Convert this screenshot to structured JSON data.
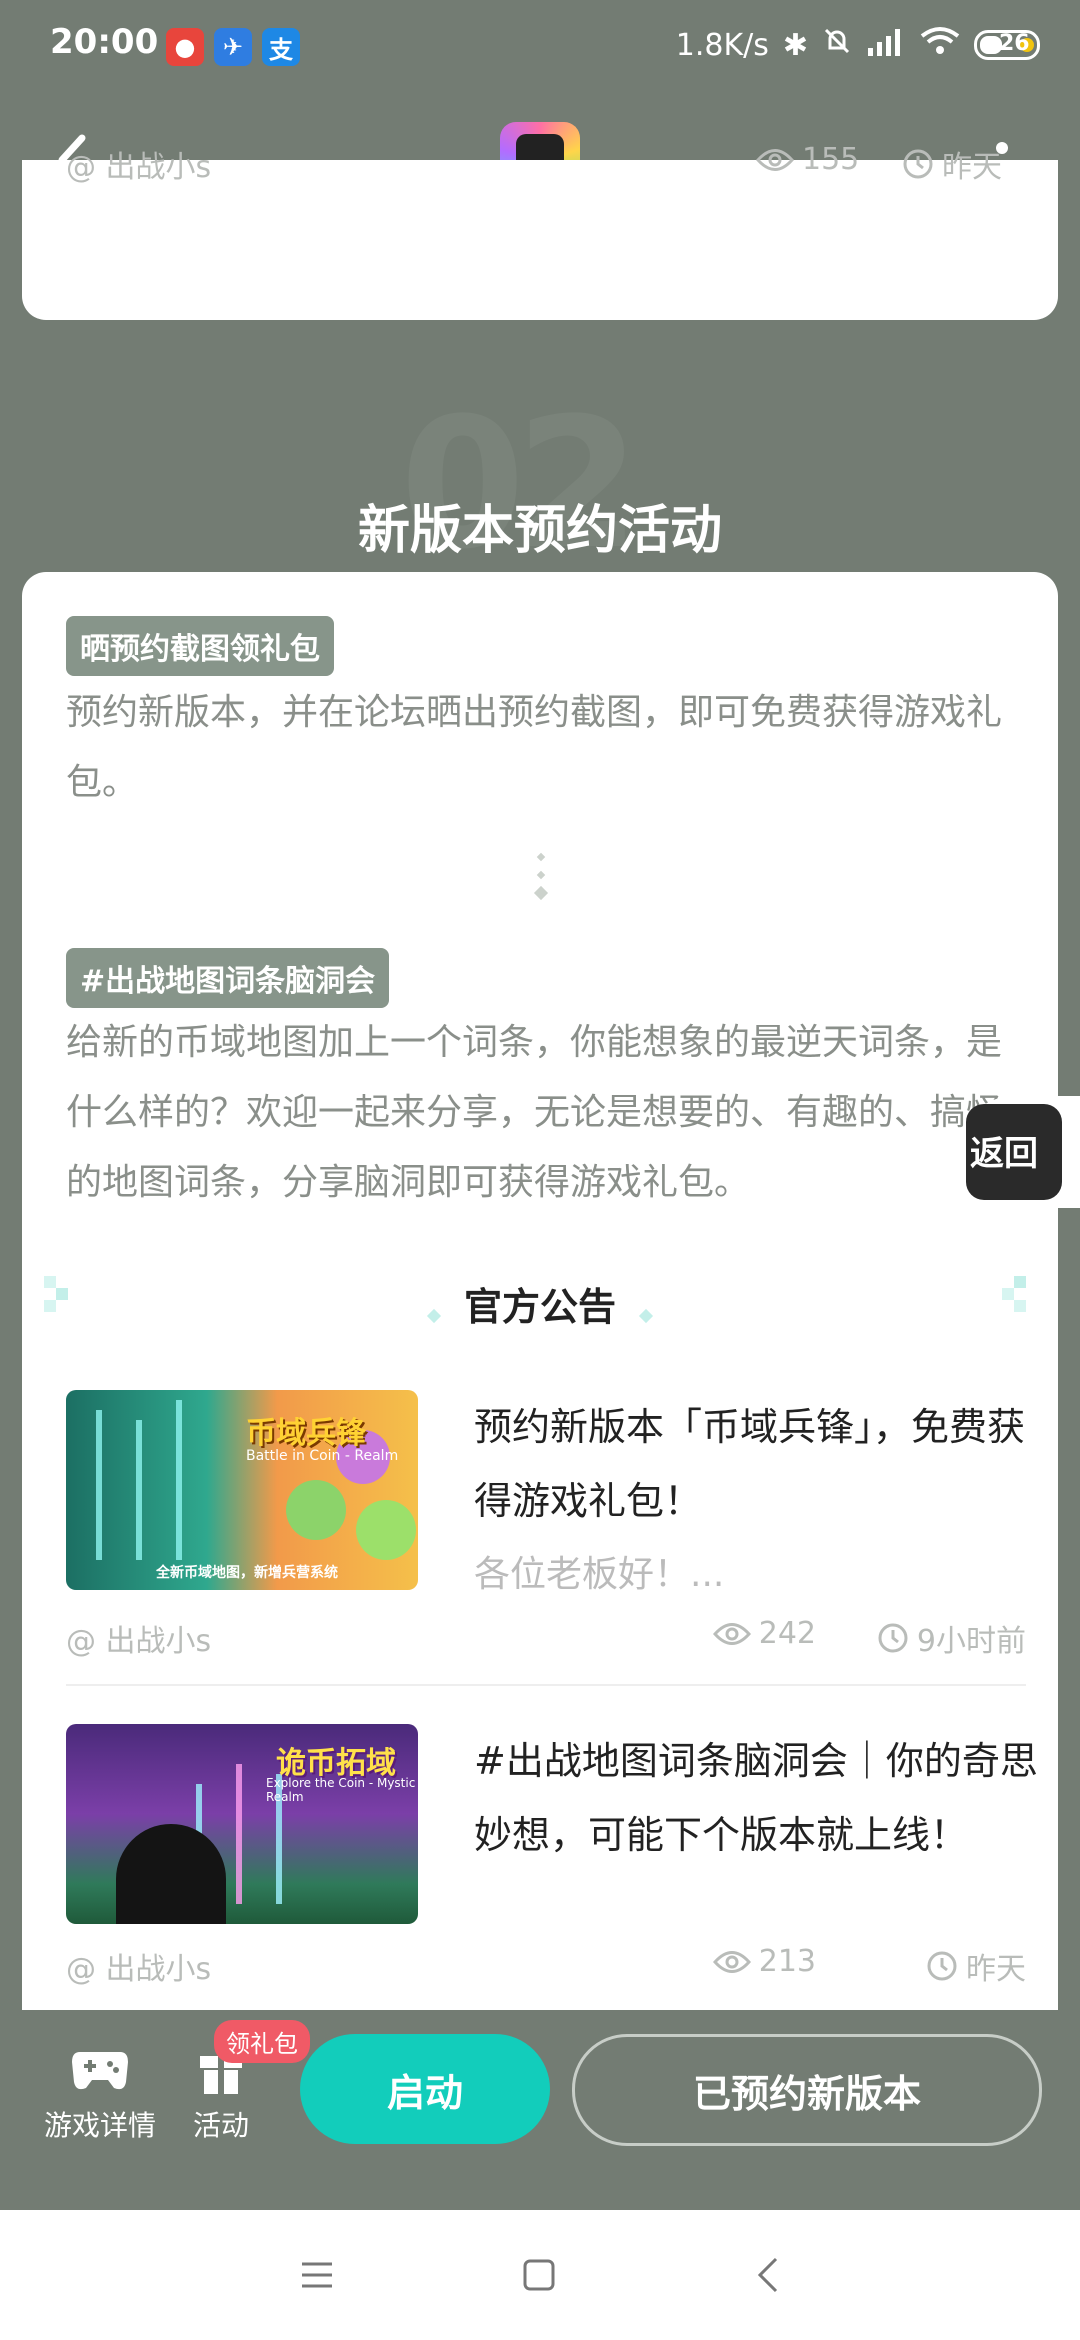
{
  "status": {
    "time": "20:00",
    "network_speed": "1.8K/s",
    "battery": "26"
  },
  "top_card": {
    "author": "@ 出战小s",
    "views": "155",
    "time": "昨天"
  },
  "section": {
    "bg_number": "02",
    "title": "新版本预约活动"
  },
  "activities": [
    {
      "tag": "晒预约截图领礼包",
      "desc": "预约新版本，并在论坛晒出预约截图，即可免费获得游戏礼包。"
    },
    {
      "tag": "#出战地图词条脑洞会",
      "desc": "给新的币域地图加上一个词条，你能想象的最逆天词条，是什么样的？欢迎一起来分享，无论是想要的、有趣的、搞怪的地图词条，分享脑洞即可获得游戏礼包。"
    }
  ],
  "notice": {
    "title": "官方公告"
  },
  "articles": [
    {
      "title": "预约新版本「币域兵锋」，免费获得游戏礼包！",
      "subtitle": "各位老板好！...",
      "thumb_title": "币域兵锋",
      "thumb_sub": "Battle in Coin - Realm",
      "thumb_caption": "全新币域地图，新增兵营系统",
      "author": "@ 出战小s",
      "views": "242",
      "time": "9小时前"
    },
    {
      "title": "#出战地图词条脑洞会｜你的奇思妙想，可能下个版本就上线！",
      "subtitle": "",
      "thumb_title": "诡币拓域",
      "thumb_sub": "Explore the Coin - Mystic Realm",
      "thumb_caption": "",
      "author": "@ 出战小s",
      "views": "213",
      "time": "昨天"
    }
  ],
  "float_button": {
    "label": "返回"
  },
  "bottom_bar": {
    "game_detail": "游戏详情",
    "activity": "活动",
    "gift_badge": "领礼包",
    "launch": "启动",
    "reserved": "已预约新版本"
  },
  "colors": {
    "background": "#737c73",
    "accent": "#12cdbb",
    "tag": "#87958a",
    "badge": "#f05a66"
  }
}
